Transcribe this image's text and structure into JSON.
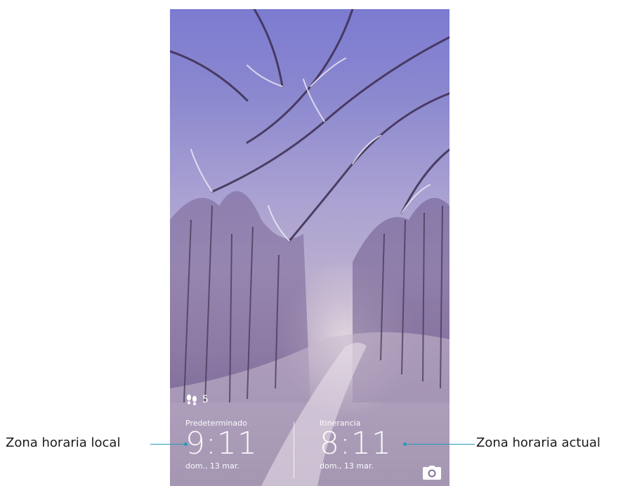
{
  "lockscreen": {
    "steps": {
      "count": "5",
      "icon": "footsteps-icon"
    },
    "local_clock": {
      "zone": "Predeterminado",
      "time": "9:11",
      "date": "dom., 13 mar."
    },
    "roaming_clock": {
      "zone": "Itinerancia",
      "time": "8:11",
      "date": "dom., 13 mar."
    },
    "camera": {
      "icon": "camera-icon"
    }
  },
  "callouts": {
    "left": "Zona horaria local",
    "right": "Zona horaria actual",
    "line_color": "#2a9ab8"
  }
}
